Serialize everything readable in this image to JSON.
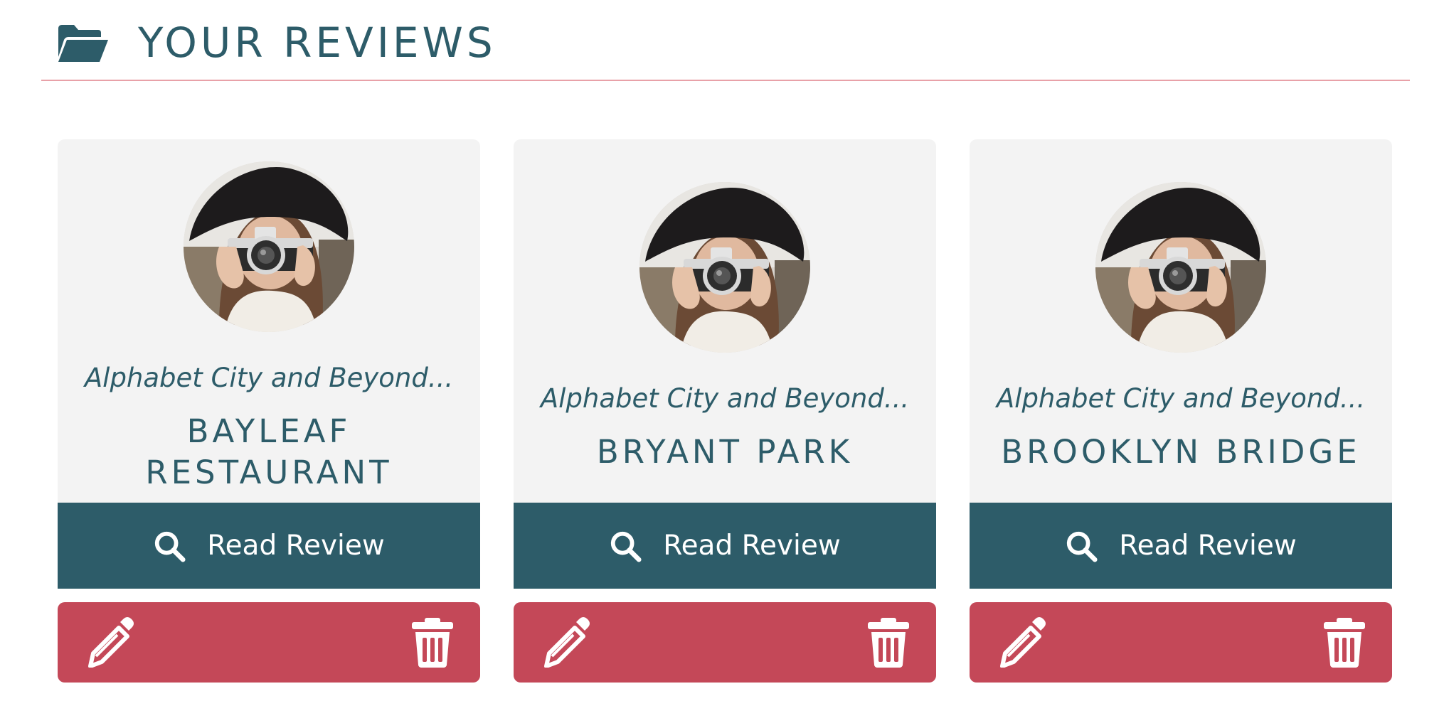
{
  "header": {
    "icon": "folder-open-icon",
    "title": "YOUR REVIEWS"
  },
  "colors": {
    "primary": "#2d5c69",
    "danger": "#c44858",
    "card_bg": "#f3f3f3",
    "divider": "#e8a1a8"
  },
  "reviews": [
    {
      "collection": "Alphabet City and Beyond...",
      "place_line1": "BAYLEAF",
      "place_line2": "RESTAURANT",
      "read_label": "Read Review",
      "edit_icon": "pencil-icon",
      "delete_icon": "trash-icon"
    },
    {
      "collection": "Alphabet City and Beyond...",
      "place_line1": "BRYANT PARK",
      "read_label": "Read Review",
      "edit_icon": "pencil-icon",
      "delete_icon": "trash-icon"
    },
    {
      "collection": "Alphabet City and Beyond...",
      "place_line1": "BROOKLYN BRIDGE",
      "read_label": "Read Review",
      "edit_icon": "pencil-icon",
      "delete_icon": "trash-icon"
    }
  ]
}
